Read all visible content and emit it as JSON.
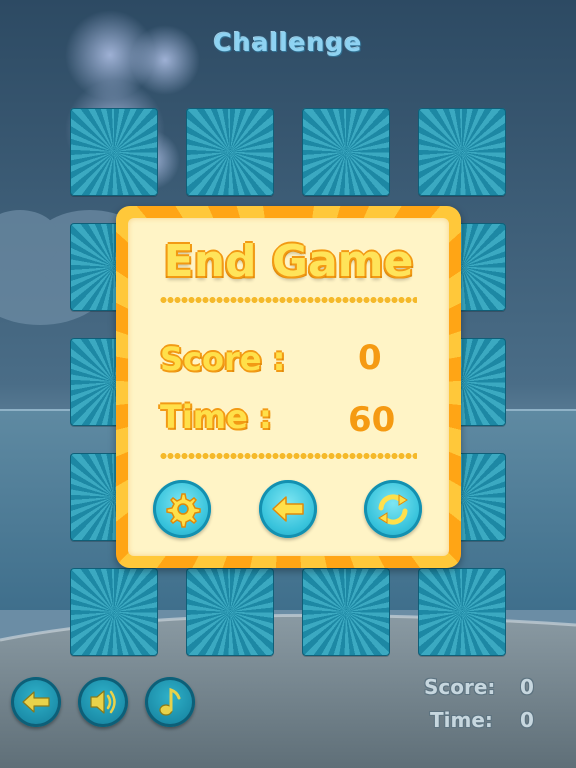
{
  "screen_title": "Challenge",
  "dialog": {
    "heading": "End Game",
    "score_label": "Score :",
    "score_value": "0",
    "time_label": "Time :",
    "time_value": "60",
    "buttons": [
      {
        "name": "settings-button",
        "icon": "gear-icon"
      },
      {
        "name": "back-button",
        "icon": "arrow-left-icon"
      },
      {
        "name": "restart-button",
        "icon": "refresh-icon"
      }
    ]
  },
  "card_grid": {
    "rows": 5,
    "cols": 4,
    "state": "face-down"
  },
  "bottom_controls": [
    {
      "name": "back-button",
      "icon": "arrow-left-icon"
    },
    {
      "name": "sound-button",
      "icon": "speaker-icon"
    },
    {
      "name": "music-button",
      "icon": "music-note-icon"
    }
  ],
  "hud": {
    "score_label": "Score:",
    "score_value": "0",
    "time_label": "Time:",
    "time_value": "0"
  },
  "colors": {
    "sky": "#3f5f78",
    "tile": "#2a98b3",
    "dialog_frame": "#ffb11f",
    "dialog_panel": "#fff4c6",
    "heading_text": "#ffe45a",
    "value_text": "#f59a12",
    "button": "#38c3dc"
  }
}
